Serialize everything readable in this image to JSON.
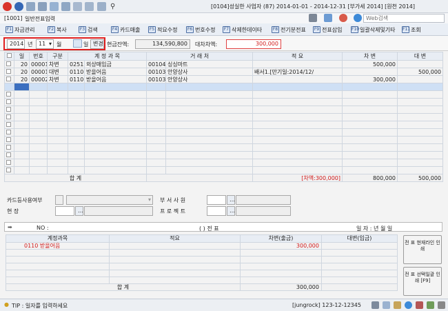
{
  "titlebar": {
    "company": "[0104]성실한 사업자",
    "cid": "(87)",
    "period": "2014-01-01 - 2014-12-31",
    "vat": "[부가세 2014]",
    "tax": "[원천 2014]",
    "search_placeholder": "Web검색"
  },
  "screen": {
    "code": "[1001]",
    "name": "일반전표입력"
  },
  "menu": [
    {
      "key": "F1",
      "label": "자금관리"
    },
    {
      "key": "F2",
      "label": "복사"
    },
    {
      "key": "F3",
      "label": "검색"
    },
    {
      "key": "F4",
      "label": "카드매출"
    },
    {
      "key": "F5",
      "label": "적요수정"
    },
    {
      "key": "F6",
      "label": "번호수정"
    },
    {
      "key": "F7",
      "label": "삭제한데이타"
    },
    {
      "key": "F8",
      "label": "전기분전표"
    },
    {
      "key": "F9",
      "label": "전표삽입"
    },
    {
      "key": "F10",
      "label": "일괄삭제및기타"
    },
    {
      "key": "F11",
      "label": "조회"
    }
  ],
  "filter": {
    "year": "2014",
    "year_unit": "년",
    "month": "11",
    "month_unit": "월",
    "day_label": "일",
    "change_button": "변경",
    "cash_label": "현금잔액:",
    "cash_value": "134,590,800",
    "diff_label": "대차차액:",
    "diff_value": "300,000"
  },
  "grid": {
    "headers": [
      "일",
      "번호",
      "구분",
      "계 정 과 목",
      "거 래 처",
      "적 요",
      "차 변",
      "대 변"
    ],
    "rows": [
      {
        "day": "20",
        "no": "00001",
        "type": "차변",
        "acode": "0251",
        "aname": "외상매입금",
        "ccode": "00104",
        "cname": "싱싱마트",
        "memo": "",
        "debit": "500,000",
        "credit": ""
      },
      {
        "day": "20",
        "no": "00001",
        "type": "대변",
        "acode": "0110",
        "aname": "받을어음",
        "ccode": "00103",
        "cname": "안양상사",
        "memo": "배서1.[만기일:2014/12/",
        "debit": "",
        "credit": "500,000"
      },
      {
        "day": "20",
        "no": "00002",
        "type": "차변",
        "acode": "0110",
        "aname": "받을어음",
        "ccode": "00103",
        "cname": "안양상사",
        "memo": "",
        "debit": "300,000",
        "credit": ""
      }
    ],
    "sum_label": "합 계",
    "sum_diff": "[차액:300,000]",
    "sum_debit": "800,000",
    "sum_credit": "500,000"
  },
  "form": {
    "card_label": "카드등사용여부",
    "dept_label": "부 서 사 원",
    "site_label": "현 장",
    "project_label": "프 로 젝 트"
  },
  "voucher": {
    "no_label": "NO :",
    "paren": "(        ) 전 표",
    "date_label": "일 자 :    년   월   일",
    "headers": [
      "계정과목",
      "적요",
      "차변(출금)",
      "대변(입금)"
    ],
    "row": {
      "code": "0110",
      "name": "받을어음",
      "memo": "",
      "debit": "300,000",
      "credit": ""
    },
    "sum_label": "합 계",
    "sum_debit": "300,000"
  },
  "buttons": {
    "print1": "전 표 현재라인 인 쇄",
    "print2": "전 표 선택일괄 인 쇄 [F9]"
  },
  "status": {
    "tip": "TIP : 일자를 입력하세요",
    "user": "[jungrock] 123-12-12345"
  },
  "colors": {
    "red": "#d01818",
    "accent": "#4a6da3",
    "selected": "#cfe0f5"
  }
}
